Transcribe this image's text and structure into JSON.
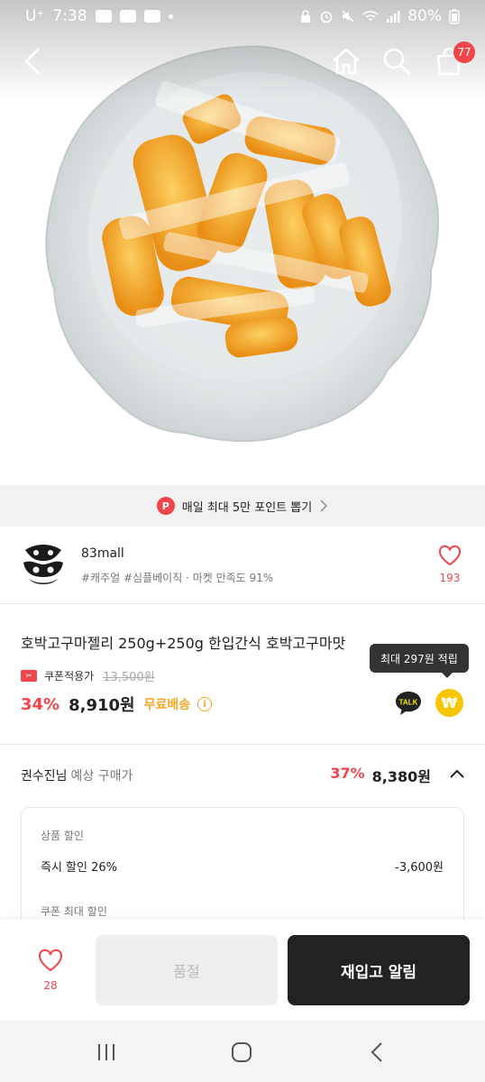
{
  "status_bar": {
    "carrier": "U⁺",
    "time": "7:38",
    "battery": "80%"
  },
  "nav": {
    "cart_count": "77"
  },
  "point_banner": {
    "badge": "P",
    "text": "매일 최대 5만 포인트 뽑기"
  },
  "seller": {
    "name": "83mall",
    "tags": "#캐주얼 #심플베이직 · 마켓 만족도 91%",
    "like_count": "193"
  },
  "product": {
    "title": "호박고구마젤리 250g+250g 한입간식 호박고구마맛",
    "coupon_label": "쿠폰적용가",
    "original_price": "13,500원",
    "discount": "34%",
    "price": "8,910원",
    "shipping": "무료배송",
    "point_tooltip": "최대 297원 적립",
    "talk_label": "TALK",
    "point_symbol": "₩"
  },
  "expected_price": {
    "user": "권수진님",
    "label": "예상 구매가",
    "discount": "37%",
    "price": "8,380원"
  },
  "breakdown": {
    "section1": "상품 할인",
    "instant_label": "즉시 할인 26%",
    "instant_value": "-3,600원",
    "section2": "쿠폰 최대 할인"
  },
  "bottom_bar": {
    "wish_count": "28",
    "soldout_label": "품절",
    "restock_label": "재입고 알림"
  },
  "colors": {
    "accent": "#f0464b",
    "free_shipping": "#f5a623",
    "point_coin": "#f7c600",
    "dark_button": "#222222"
  }
}
